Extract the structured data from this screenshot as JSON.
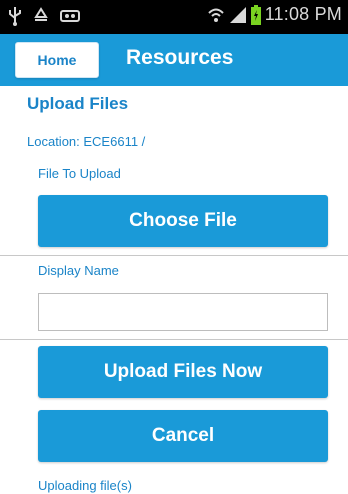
{
  "status_bar": {
    "time": "11:08 PM",
    "icons": [
      "usb-icon",
      "recycle-icon",
      "voicemail-icon",
      "wifi-icon",
      "signal-icon",
      "battery-icon"
    ]
  },
  "header": {
    "home_label": "Home",
    "title": "Resources"
  },
  "main": {
    "heading": "Upload Files",
    "location": "Location: ECE6611 /",
    "file_label": "File To Upload",
    "choose_file_label": "Choose File",
    "display_name_label": "Display Name",
    "display_name_value": "",
    "upload_now_label": "Upload Files Now",
    "cancel_label": "Cancel",
    "uploading_status": "Uploading file(s)"
  },
  "colors": {
    "accent": "#1a9ad8",
    "text_accent": "#1a84c8",
    "status_bar_bg": "#000000",
    "battery_green": "#7ad321"
  }
}
